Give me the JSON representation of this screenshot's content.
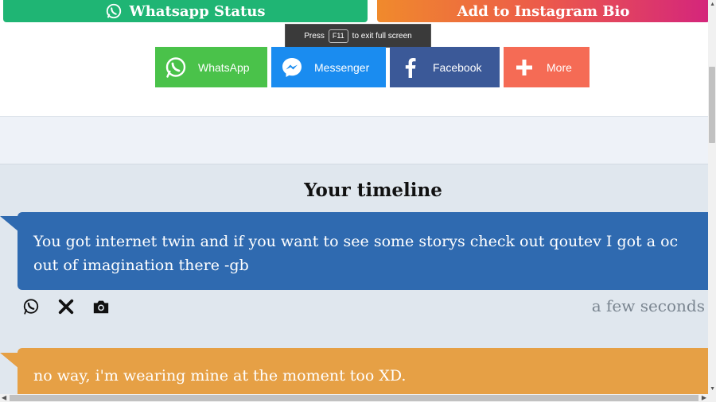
{
  "top_buttons": {
    "whatsapp_status": "Whatsapp Status",
    "instagram_bio": "Add to Instagram Bio"
  },
  "fullscreen_notice": {
    "press": "Press",
    "key": "F11",
    "suffix": "to exit full screen"
  },
  "share": {
    "whatsapp": "WhatsApp",
    "messenger": "Messenger",
    "facebook": "Facebook",
    "more": "More"
  },
  "timeline": {
    "title": "Your timeline",
    "messages": [
      {
        "text": "You got internet twin and if you want to see some storys check out qoutev I got a oc out of imagination there -gb",
        "time": "a few seconds",
        "color": "#2f6ab0"
      },
      {
        "text": "no way, i'm wearing mine at the moment too XD.",
        "color": "#e6a045"
      }
    ],
    "action_icons": [
      "whatsapp-icon",
      "close-icon",
      "camera-icon"
    ]
  },
  "colors": {
    "whatsapp_green": "#4ac24a",
    "messenger_blue": "#1a8cf0",
    "facebook_blue": "#3b5998",
    "more_red": "#f56b55"
  }
}
